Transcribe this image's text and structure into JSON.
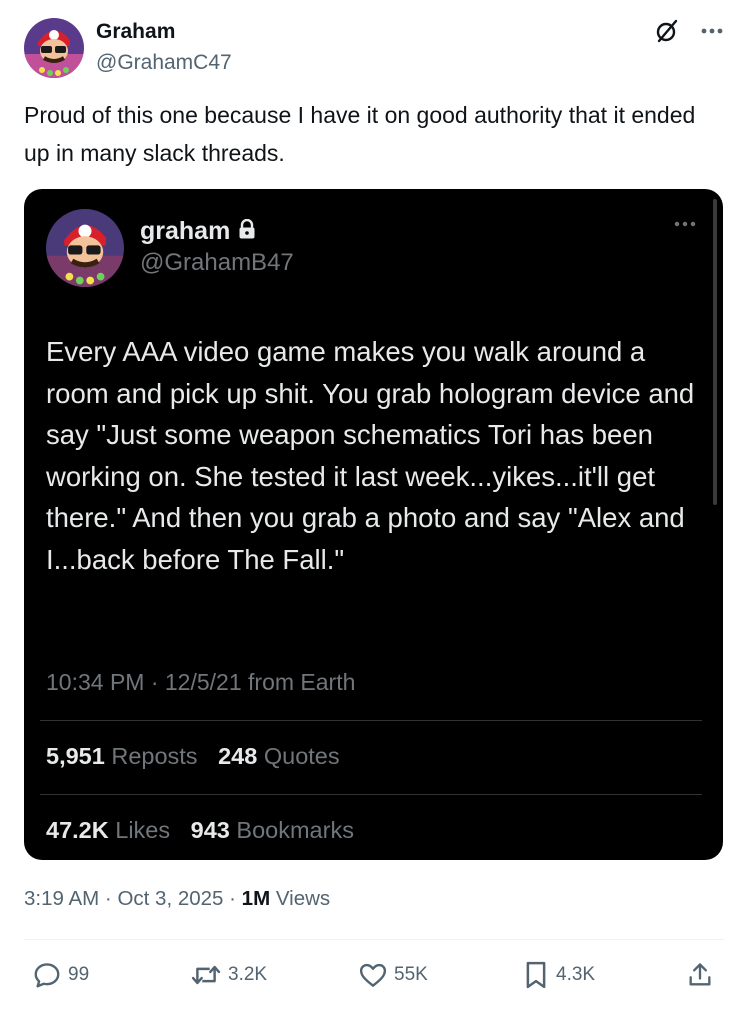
{
  "author": {
    "name": "Graham",
    "handle": "@GrahamC47"
  },
  "tweet": {
    "text": "Proud of this one because I have it on good authority that it ended up in many slack threads.",
    "time": "3:19 AM",
    "date": "Oct 3, 2025",
    "views_count": "1M",
    "views_label": "Views"
  },
  "quoted": {
    "name": "graham",
    "handle": "@GrahamB47",
    "text": "Every AAA video game makes you walk around a room and pick up shit. You grab hologram device and say \"Just some weapon schematics Tori has been working on. She tested it last week...yikes...it'll get there.\" And then you grab a photo and say \"Alex and I...back before The Fall.\"",
    "timestamp": "10:34 PM · 12/5/21 from Earth",
    "reposts": "5,951",
    "reposts_label": "Reposts",
    "quotes": "248",
    "quotes_label": "Quotes",
    "likes": "47.2K",
    "likes_label": "Likes",
    "bookmarks": "943",
    "bookmarks_label": "Bookmarks"
  },
  "actions": {
    "replies": "99",
    "retweets": "3.2K",
    "likes": "55K",
    "bookmarks": "4.3K"
  },
  "colors": {
    "text_primary": "#0f1419",
    "text_secondary": "#536471",
    "card_bg": "#000000",
    "card_text": "#e7e9ea",
    "card_muted": "#71767b"
  },
  "icons": [
    "avatar-mario",
    "grok-icon",
    "more-icon",
    "lock-icon",
    "reply-icon",
    "retweet-icon",
    "like-icon",
    "bookmark-icon",
    "share-icon"
  ]
}
